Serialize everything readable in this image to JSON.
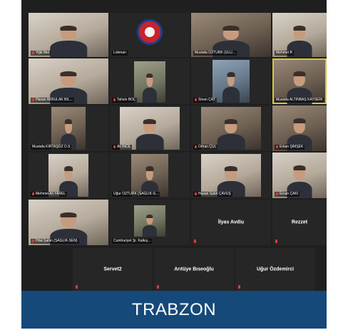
{
  "tiles": [
    {
      "name": "Yiğit Mel"
    },
    {
      "name": "Lokman"
    },
    {
      "name": "Mustafa ÖZTÜRK (ULU..."
    },
    {
      "name": "Mehmet B"
    },
    {
      "name": "Hasan AKBULAK BİL..."
    },
    {
      "name": "Tahsin BOL"
    },
    {
      "name": "Sinan ÇAT"
    },
    {
      "name": "Mustafa ALTINBAŞ KAYSERİ"
    },
    {
      "name": "Mustafa KIRTAŞÖZ D.S"
    },
    {
      "name": "Ali İNCE"
    },
    {
      "name": "Orhan ÇUL"
    },
    {
      "name": "Erkan ŞİMŞEK"
    },
    {
      "name": "Mehmet Ali YAREL"
    },
    {
      "name": "Uğur ÖZTÜRK (SAĞLIK-S..."
    },
    {
      "name": "Hasan Sabri ÇAVUŞ"
    },
    {
      "name": "Ercan ÇAKI"
    },
    {
      "name": "Hilal Şahin (SAĞLIK-SEN)"
    },
    {
      "name": "Cumhuriyet Şr. Kalkış..."
    },
    {
      "name": "İlyas Avdiu"
    },
    {
      "name": "Rezzet"
    },
    {
      "name": "Servet2"
    },
    {
      "name": "Arıtüye Bıseoğlu"
    },
    {
      "name": "Uğur Özdemirci"
    }
  ],
  "banner": {
    "label": "TRABZON"
  },
  "colors": {
    "banner": "#15497a",
    "grid": "#1f1f1f",
    "active_border": "#d8c640",
    "mic_muted": "#e23a3a"
  }
}
